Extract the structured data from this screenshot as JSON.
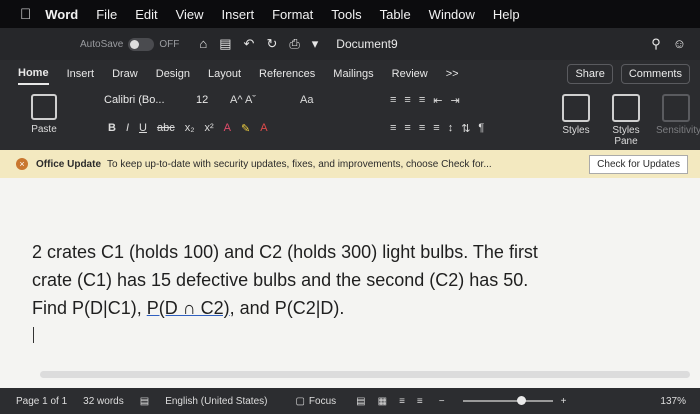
{
  "menubar": {
    "app": "Word",
    "items": [
      "File",
      "Edit",
      "View",
      "Insert",
      "Format",
      "Tools",
      "Table",
      "Window",
      "Help"
    ]
  },
  "titlebar": {
    "autosave": "AutoSave",
    "autosave_state": "OFF",
    "document_title": "Document9"
  },
  "tabs": [
    "Home",
    "Insert",
    "Draw",
    "Design",
    "Layout",
    "References",
    "Mailings",
    "Review",
    ">>"
  ],
  "share": {
    "share_label": "Share",
    "comments_label": "Comments"
  },
  "ribbon": {
    "paste_label": "Paste",
    "font_name": "Calibri (Bo...",
    "font_size": "12",
    "grow": "A^  Aˇ",
    "change_case": "Aa",
    "bold": "B",
    "italic": "I",
    "underline": "U",
    "strike": "abc",
    "subscript": "x₂",
    "superscript": "x²",
    "styles_label": "Styles",
    "styles_pane_label": "Styles Pane",
    "sensitivity_label": "Sensitivity"
  },
  "banner": {
    "title": "Office Update",
    "message": "To keep up-to-date with security updates, fixes, and improvements, choose Check for...",
    "button": "Check for Updates"
  },
  "document": {
    "line1": "2 crates C1 (holds 100) and C2 (holds 300) light bulbs. The first",
    "line2": "crate (C1) has 15 defective bulbs and the second (C2) has 50.",
    "line3_a": "Find P(D|C1), ",
    "line3_b": "P(D ∩ C2)",
    "line3_c": ", and P(C2|D)."
  },
  "status": {
    "page": "Page 1 of 1",
    "words": "32 words",
    "language": "English (United States)",
    "focus": "Focus",
    "zoom": "137%"
  }
}
